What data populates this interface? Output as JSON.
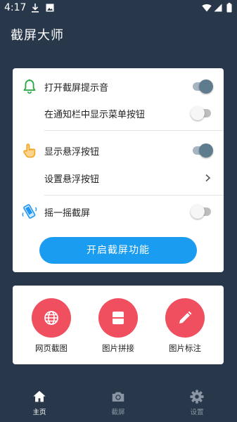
{
  "status_bar": {
    "time": "4:17",
    "left_icons": [
      "download-icon",
      "photo-icon"
    ],
    "right_icons": [
      "wifi-icon",
      "cellular-icon",
      "battery-icon"
    ]
  },
  "app": {
    "title": "截屏大师"
  },
  "settings": {
    "rows": [
      {
        "label": "打开截屏提示音",
        "icon": "bell-icon",
        "toggle": true
      },
      {
        "label": "在通知栏中显示菜单按钮",
        "icon": null,
        "toggle": false
      },
      {
        "label": "显示悬浮按钮",
        "icon": "hand-pointer-icon",
        "toggle": true
      },
      {
        "label": "设置悬浮按钮",
        "icon": null,
        "toggle": null
      },
      {
        "label": "摇一摇截屏",
        "icon": "shake-phone-icon",
        "toggle": false
      }
    ],
    "start_button": "开启截屏功能"
  },
  "tools": [
    {
      "label": "网页截图",
      "icon": "globe-icon"
    },
    {
      "label": "图片拼接",
      "icon": "stitch-icon"
    },
    {
      "label": "图片标注",
      "icon": "pencil-icon"
    }
  ],
  "bottom_nav": [
    {
      "label": "主页",
      "icon": "home-icon",
      "active": true
    },
    {
      "label": "截屏",
      "icon": "camera-icon",
      "active": false
    },
    {
      "label": "设置",
      "icon": "gear-icon",
      "active": false
    }
  ],
  "colors": {
    "background": "#283749",
    "accent_blue": "#1a9df0",
    "tool_red": "#ef4f5e",
    "toggle_on": "#5f7b8e",
    "bell_green": "#27a745",
    "hand_orange": "#f4a51e"
  }
}
